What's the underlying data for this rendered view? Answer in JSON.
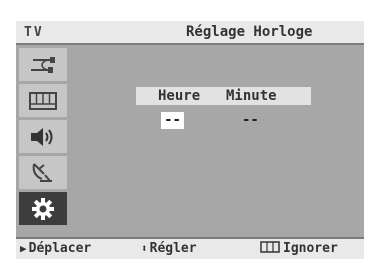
{
  "header": {
    "source_label": "TV",
    "menu_title": "Réglage Horloge"
  },
  "sidebar": {
    "items": [
      {
        "icon": "input-plug-icon"
      },
      {
        "icon": "picture-icon"
      },
      {
        "icon": "sound-speaker-icon"
      },
      {
        "icon": "channel-antenna-icon"
      },
      {
        "icon": "setup-gear-icon",
        "active": true
      }
    ]
  },
  "clock": {
    "hour_label": "Heure",
    "minute_label": "Minute",
    "hour_value": "--",
    "minute_value": "--"
  },
  "footer": {
    "move_glyph": "▶",
    "move_label": "Déplacer",
    "adjust_glyph": "⬍",
    "adjust_label": "Régler",
    "ignore_label": "Ignorer"
  },
  "colors": {
    "osd_background": "#a7a7a7",
    "bar_background": "#e9e9e9",
    "sidebar_item": "#c6c6c6",
    "sidebar_active": "#3d3d3d",
    "field_highlight": "#ffffff"
  }
}
